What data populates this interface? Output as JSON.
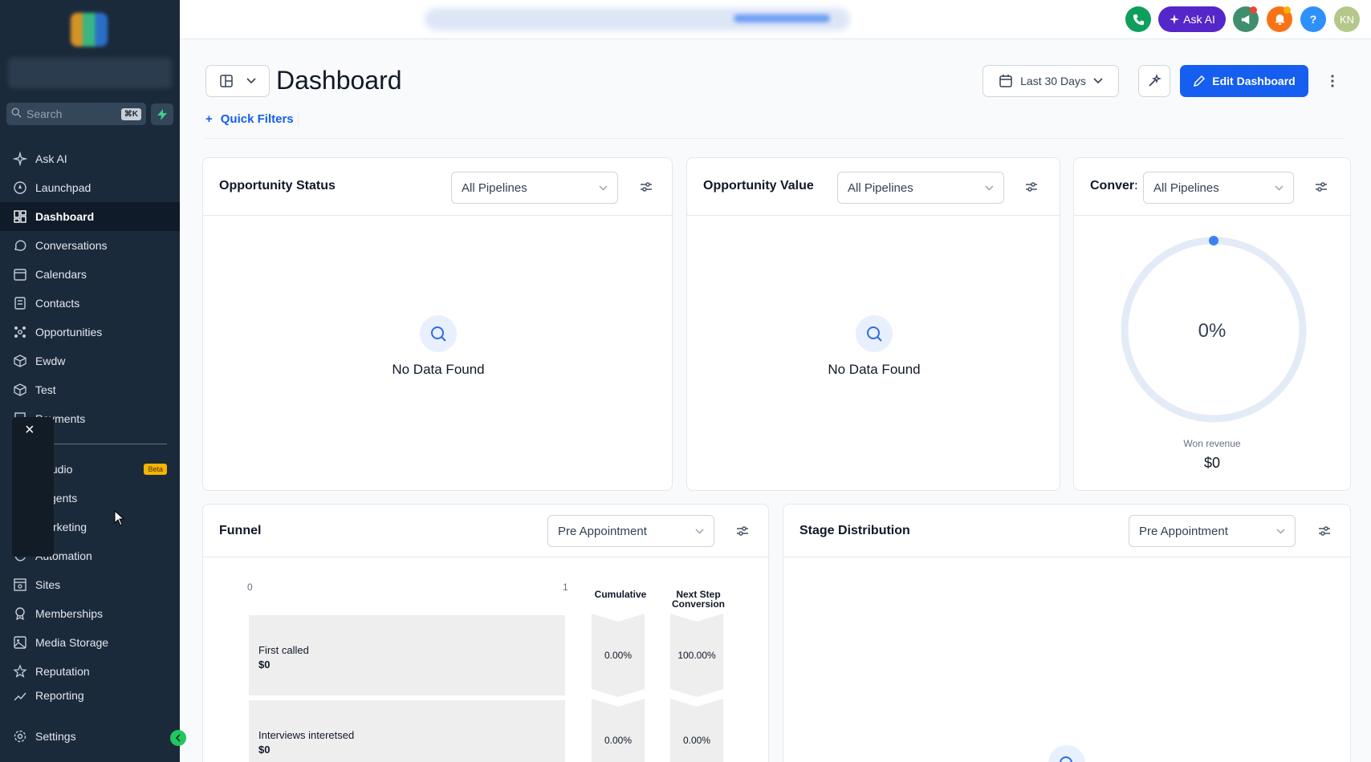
{
  "sidebar": {
    "search_placeholder": "Search",
    "search_shortcut": "⌘K",
    "items": [
      {
        "label": "Ask AI",
        "icon": "sparkle-icon"
      },
      {
        "label": "Launchpad",
        "icon": "rocket-icon"
      },
      {
        "label": "Dashboard",
        "icon": "grid-icon",
        "active": true
      },
      {
        "label": "Conversations",
        "icon": "chat-icon"
      },
      {
        "label": "Calendars",
        "icon": "calendar-icon"
      },
      {
        "label": "Contacts",
        "icon": "contacts-icon"
      },
      {
        "label": "Opportunities",
        "icon": "network-icon"
      },
      {
        "label": "Ewdw",
        "icon": "box-icon"
      },
      {
        "label": "Test",
        "icon": "box-icon"
      },
      {
        "label": "Payments",
        "icon": "receipt-icon"
      },
      {
        "label": "tudio",
        "icon": "studio-icon",
        "badge": "Beta"
      },
      {
        "label": "gents",
        "icon": "agents-icon"
      },
      {
        "label": "rketing",
        "icon": "marketing-icon"
      },
      {
        "label": "Automation",
        "icon": "automation-icon"
      },
      {
        "label": "Sites",
        "icon": "sites-icon"
      },
      {
        "label": "Memberships",
        "icon": "award-icon"
      },
      {
        "label": "Media Storage",
        "icon": "image-icon"
      },
      {
        "label": "Reputation",
        "icon": "star-icon"
      },
      {
        "label": "Reporting",
        "icon": "chart-icon"
      }
    ],
    "settings_label": "Settings",
    "tooltip_close": "×"
  },
  "topbar": {
    "ask_ai_label": "Ask AI",
    "help_label": "?",
    "avatar_initials": "KN"
  },
  "header": {
    "title": "Dashboard",
    "date_range": "Last 30 Days",
    "edit_label": "Edit Dashboard",
    "quick_filters_label": "Quick Filters"
  },
  "widgets": {
    "opportunity_status": {
      "title": "Opportunity Status",
      "filter": "All Pipelines",
      "empty_text": "No Data Found"
    },
    "opportunity_value": {
      "title": "Opportunity Value",
      "filter": "All Pipelines",
      "empty_text": "No Data Found"
    },
    "conversion": {
      "title": "Conver:",
      "filter": "All Pipelines",
      "percent": "0%",
      "won_label": "Won revenue",
      "won_value": "$0",
      "progress": 0
    },
    "funnel": {
      "title": "Funnel",
      "filter": "Pre Appointment",
      "axis_min": "0",
      "axis_max": "1",
      "col_cumulative": "Cumulative",
      "col_next_1": "Next Step",
      "col_next_2": "Conversion",
      "stages": [
        {
          "name": "First called",
          "value": "$0",
          "cumulative": "0.00%",
          "next": "100.00%"
        },
        {
          "name": "Interviews interetsed",
          "value": "$0",
          "cumulative": "0.00%",
          "next": "0.00%"
        }
      ]
    },
    "stage_distribution": {
      "title": "Stage Distribution",
      "filter": "Pre Appointment"
    }
  },
  "colors": {
    "accent": "#155eef",
    "sidebar_bg": "#1b2a3b",
    "ask_ai": "#5526c9"
  }
}
